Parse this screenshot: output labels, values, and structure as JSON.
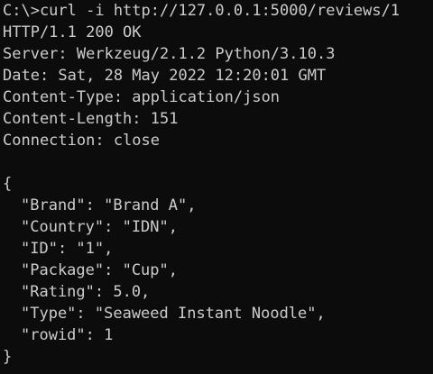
{
  "terminal": {
    "command_line": "C:\\>curl -i http://127.0.0.1:5000/reviews/1",
    "headers": [
      "HTTP/1.1 200 OK",
      "Server: Werkzeug/2.1.2 Python/3.10.3",
      "Date: Sat, 28 May 2022 12:20:01 GMT",
      "Content-Type: application/json",
      "Content-Length: 151",
      "Connection: close"
    ],
    "body_open": "{",
    "body_lines": [
      "\"Brand\": \"Brand A\",",
      "\"Country\": \"IDN\",",
      "\"ID\": \"1\",",
      "\"Package\": \"Cup\",",
      "\"Rating\": 5.0,",
      "\"Type\": \"Seaweed Instant Noodle\",",
      "\"rowid\": 1"
    ],
    "body_close": "}"
  },
  "colors": {
    "background": "#0c0c0c",
    "text": "#cccccc"
  }
}
